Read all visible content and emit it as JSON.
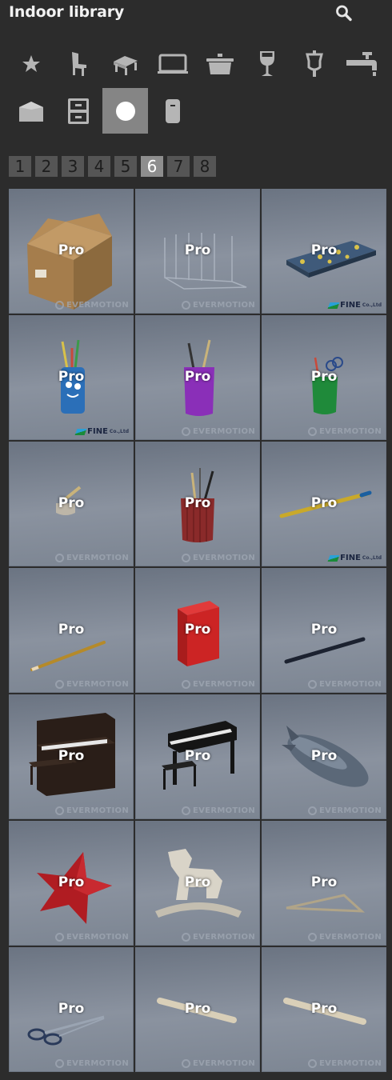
{
  "header": {
    "title": "Indoor library",
    "search_icon": "search-icon"
  },
  "categories": [
    {
      "name": "favorites",
      "icon": "star-icon",
      "active": false
    },
    {
      "name": "chairs",
      "icon": "chair-icon",
      "active": false
    },
    {
      "name": "tables",
      "icon": "table-icon",
      "active": false
    },
    {
      "name": "electronics",
      "icon": "laptop-icon",
      "active": false
    },
    {
      "name": "kitchen",
      "icon": "pot-icon",
      "active": false
    },
    {
      "name": "tableware",
      "icon": "wine-glass-icon",
      "active": false
    },
    {
      "name": "lighting",
      "icon": "lamp-icon",
      "active": false
    },
    {
      "name": "bathroom",
      "icon": "faucet-icon",
      "active": false
    },
    {
      "name": "boxes",
      "icon": "box-icon",
      "active": false
    },
    {
      "name": "cabinets",
      "icon": "cabinet-icon",
      "active": false
    },
    {
      "name": "decor",
      "icon": "circle-icon",
      "active": true
    },
    {
      "name": "misc",
      "icon": "cylinder-icon",
      "active": false
    }
  ],
  "pagination": {
    "pages": [
      "1",
      "2",
      "3",
      "4",
      "5",
      "6",
      "7",
      "8"
    ],
    "current": "6"
  },
  "badge_label": "Pro",
  "watermarks": {
    "evermotion": "EVERMOTION",
    "fine": "FINE",
    "fine_sub": "Co.,Ltd"
  },
  "items": [
    {
      "name": "cardboard-box",
      "badge": "Pro",
      "brand": "evermotion"
    },
    {
      "name": "wire-paper-holder",
      "badge": "Pro",
      "brand": "evermotion"
    },
    {
      "name": "pencil-case",
      "badge": "Pro",
      "brand": "fine"
    },
    {
      "name": "blue-pencil-cup",
      "badge": "Pro",
      "brand": "fine"
    },
    {
      "name": "purple-pencil-cup",
      "badge": "Pro",
      "brand": "evermotion"
    },
    {
      "name": "green-pencil-cup",
      "badge": "Pro",
      "brand": "evermotion"
    },
    {
      "name": "pen-stand",
      "badge": "Pro",
      "brand": "evermotion"
    },
    {
      "name": "red-pencil-cup",
      "badge": "Pro",
      "brand": "evermotion"
    },
    {
      "name": "yellow-pencil",
      "badge": "Pro",
      "brand": "fine"
    },
    {
      "name": "pencil",
      "badge": "Pro",
      "brand": "evermotion"
    },
    {
      "name": "red-desk-organizer",
      "badge": "Pro",
      "brand": "evermotion"
    },
    {
      "name": "black-pen",
      "badge": "Pro",
      "brand": "evermotion"
    },
    {
      "name": "upright-piano",
      "badge": "Pro",
      "brand": "evermotion"
    },
    {
      "name": "digital-piano",
      "badge": "Pro",
      "brand": "evermotion"
    },
    {
      "name": "airship-toy",
      "badge": "Pro",
      "brand": "evermotion"
    },
    {
      "name": "star-pillow",
      "badge": "Pro",
      "brand": "evermotion"
    },
    {
      "name": "rocking-horse",
      "badge": "Pro",
      "brand": "evermotion"
    },
    {
      "name": "triangle-ruler",
      "badge": "Pro",
      "brand": "evermotion"
    },
    {
      "name": "scissors",
      "badge": "Pro",
      "brand": "evermotion"
    },
    {
      "name": "paper-roll",
      "badge": "Pro",
      "brand": "evermotion"
    },
    {
      "name": "paper-roll-2",
      "badge": "Pro",
      "brand": "evermotion"
    }
  ],
  "colors": {
    "background": "#2c2c2c",
    "active_category": "#858585",
    "page_button": "#555555",
    "page_active": "#8e8e8e",
    "tile": "#7c8592"
  }
}
